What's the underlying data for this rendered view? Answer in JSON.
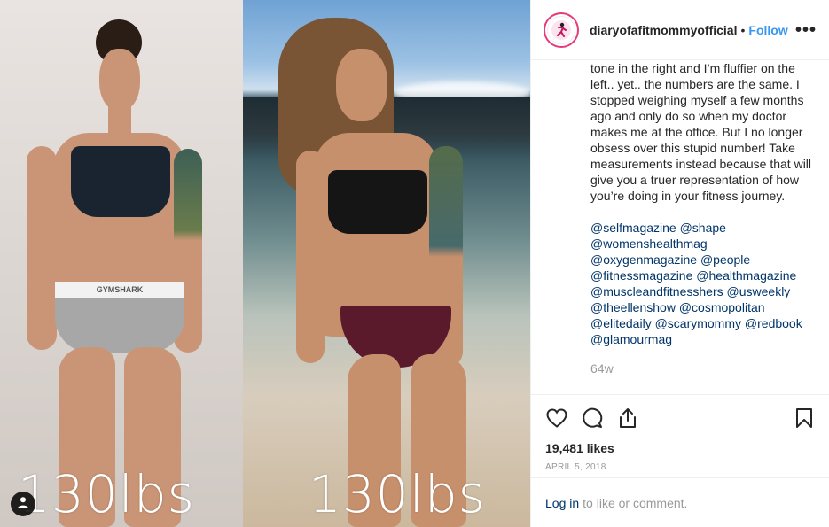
{
  "media": {
    "left_caption": "130lbs",
    "right_caption": "130lbs",
    "waistband_text": "GYMSHARK"
  },
  "header": {
    "username": "diaryofafitmommyofficial",
    "separator": "•",
    "follow_label": "Follow",
    "more_label": "•••"
  },
  "caption": {
    "text": "tone in the right and I’m fluffier on the left.. yet.. the numbers are the same. I stopped weighing myself a few months ago and only do so when my doctor makes me at the office. But I no longer obsess over this stupid number! Take measurements instead because that will give you a truer representation of how you’re doing in your fitness journey.",
    "tags": [
      "@selfmagazine",
      "@shape",
      "@womenshealthmag",
      "@oxygenmagazine",
      "@people",
      "@fitnessmagazine",
      "@healthmagazine",
      "@muscleandfitnesshers",
      "@usweekly",
      "@theellenshow",
      "@cosmopolitan",
      "@elitedaily",
      "@scarymommy",
      "@redbook",
      "@glamourmag"
    ],
    "time_ago": "64w"
  },
  "actions": {
    "likes": "19,481 likes",
    "date": "APRIL 5, 2018"
  },
  "login": {
    "link": "Log in",
    "rest": "to like or comment."
  },
  "colors": {
    "link_blue": "#3897f0",
    "tag_blue": "#003569",
    "muted": "#999999",
    "text": "#262626"
  },
  "icons": [
    "user-tag-icon",
    "heart-icon",
    "comment-icon",
    "share-icon",
    "bookmark-icon",
    "more-icon"
  ]
}
